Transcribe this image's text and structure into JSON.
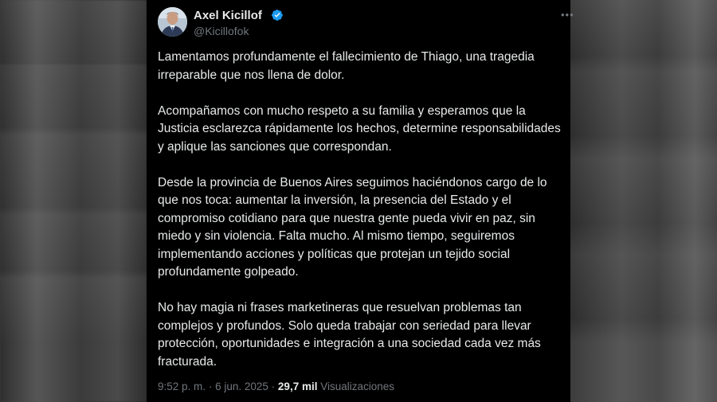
{
  "tweet": {
    "author_name": "Axel Kicillof",
    "author_handle": "@Kicillofok",
    "paragraphs": [
      "Lamentamos profundamente el fallecimiento de Thiago, una tragedia irreparable que nos llena de dolor.",
      "Acompañamos con mucho respeto a su familia y esperamos que la Justicia esclarezca rápidamente los hechos, determine responsabilidades y aplique las sanciones que correspondan.",
      "Desde la provincia de Buenos Aires seguimos haciéndonos cargo de lo que nos toca: aumentar la inversión, la presencia del Estado y el compromiso cotidiano para que nuestra gente pueda vivir en paz, sin miedo y sin violencia. Falta mucho. Al mismo tiempo, seguiremos implementando acciones y políticas que protejan un tejido social profundamente golpeado.",
      "No hay magia ni frases marketineras que resuelvan problemas tan complejos y profundos. Solo queda trabajar con seriedad para llevar protección, oportunidades e integración a una sociedad cada vez más fracturada."
    ],
    "time": "9:52 p. m.",
    "separator": "·",
    "date": "6 jun. 2025",
    "views_count": "29,7 mil",
    "views_label": "Visualizaciones",
    "more_icon": "more-dots-icon",
    "verified_icon": "verified-badge-icon"
  },
  "colors": {
    "background": "#000000",
    "text": "#e7e9ea",
    "secondary": "#71767b",
    "verified": "#1d9bf0"
  }
}
